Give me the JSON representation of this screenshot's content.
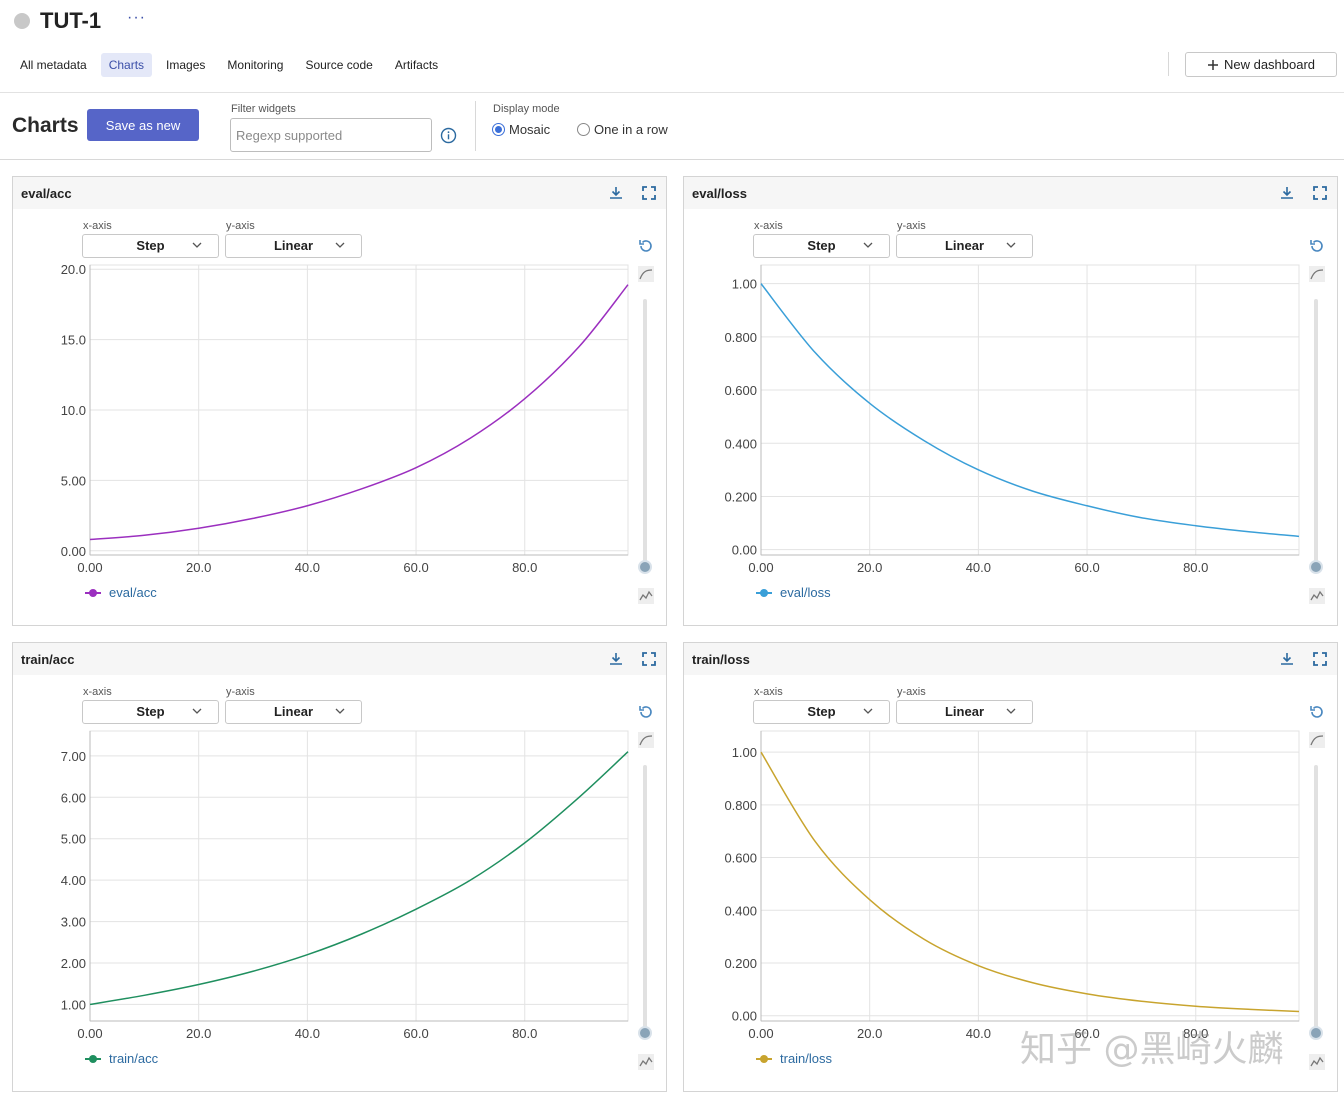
{
  "header": {
    "title": "TUT-1",
    "more_label": "···"
  },
  "tabs": [
    {
      "label": "All metadata",
      "active": false
    },
    {
      "label": "Charts",
      "active": true
    },
    {
      "label": "Images",
      "active": false
    },
    {
      "label": "Monitoring",
      "active": false
    },
    {
      "label": "Source code",
      "active": false
    },
    {
      "label": "Artifacts",
      "active": false
    }
  ],
  "new_dashboard_label": "New dashboard",
  "toolbar": {
    "title": "Charts",
    "save_label": "Save as new",
    "filter_label": "Filter widgets",
    "filter_placeholder": "Regexp supported",
    "display_mode_label": "Display mode",
    "mode_mosaic": "Mosaic",
    "mode_row": "One in a row",
    "selected_mode": "Mosaic"
  },
  "accent": "#5665c8",
  "watermark": "知乎 @黑崎火麟",
  "panels": [
    {
      "title": "eval/acc",
      "xaxis_label": "x-axis",
      "yaxis_label": "y-axis",
      "xaxis_value": "Step",
      "yaxis_value": "Linear",
      "legend": "eval/acc",
      "color": "#9b2fbf"
    },
    {
      "title": "eval/loss",
      "xaxis_label": "x-axis",
      "yaxis_label": "y-axis",
      "xaxis_value": "Step",
      "yaxis_value": "Linear",
      "legend": "eval/loss",
      "color": "#3a9fd8"
    },
    {
      "title": "train/acc",
      "xaxis_label": "x-axis",
      "yaxis_label": "y-axis",
      "xaxis_value": "Step",
      "yaxis_value": "Linear",
      "legend": "train/acc",
      "color": "#1f8f5f"
    },
    {
      "title": "train/loss",
      "xaxis_label": "x-axis",
      "yaxis_label": "y-axis",
      "xaxis_value": "Step",
      "yaxis_value": "Linear",
      "legend": "train/loss",
      "color": "#c8a42e"
    }
  ],
  "chart_data": [
    {
      "type": "line",
      "title": "eval/acc",
      "x": [
        0,
        10,
        20,
        30,
        40,
        50,
        60,
        70,
        80,
        90,
        99
      ],
      "series": [
        {
          "name": "eval/acc",
          "values": [
            0.8,
            1.1,
            1.6,
            2.3,
            3.2,
            4.4,
            5.9,
            8.0,
            10.8,
            14.5,
            18.9
          ]
        }
      ],
      "xlim": [
        0,
        99
      ],
      "ylim": [
        -0.3,
        20.3
      ],
      "x_ticks": [
        "0.00",
        "20.0",
        "40.0",
        "60.0",
        "80.0"
      ],
      "x_tick_values": [
        0,
        20,
        40,
        60,
        80
      ],
      "y_ticks": [
        "0.00",
        "5.00",
        "10.0",
        "15.0",
        "20.0"
      ],
      "y_tick_values": [
        0,
        5,
        10,
        15,
        20
      ]
    },
    {
      "type": "line",
      "title": "eval/loss",
      "x": [
        0,
        10,
        20,
        30,
        40,
        50,
        60,
        70,
        80,
        90,
        99
      ],
      "series": [
        {
          "name": "eval/loss",
          "values": [
            1.0,
            0.74,
            0.55,
            0.41,
            0.3,
            0.22,
            0.165,
            0.12,
            0.09,
            0.067,
            0.05
          ]
        }
      ],
      "xlim": [
        0,
        99
      ],
      "ylim": [
        -0.02,
        1.07
      ],
      "x_ticks": [
        "0.00",
        "20.0",
        "40.0",
        "60.0",
        "80.0"
      ],
      "x_tick_values": [
        0,
        20,
        40,
        60,
        80
      ],
      "y_ticks": [
        "0.00",
        "0.200",
        "0.400",
        "0.600",
        "0.800",
        "1.00"
      ],
      "y_tick_values": [
        0,
        0.2,
        0.4,
        0.6,
        0.8,
        1.0
      ]
    },
    {
      "type": "line",
      "title": "train/acc",
      "x": [
        0,
        10,
        20,
        30,
        40,
        50,
        60,
        70,
        80,
        90,
        99
      ],
      "series": [
        {
          "name": "train/acc",
          "values": [
            1.0,
            1.22,
            1.48,
            1.8,
            2.2,
            2.7,
            3.3,
            4.0,
            4.9,
            6.0,
            7.1
          ]
        }
      ],
      "xlim": [
        0,
        99
      ],
      "ylim": [
        0.6,
        7.6
      ],
      "x_ticks": [
        "0.00",
        "20.0",
        "40.0",
        "60.0",
        "80.0"
      ],
      "x_tick_values": [
        0,
        20,
        40,
        60,
        80
      ],
      "y_ticks": [
        "1.00",
        "2.00",
        "3.00",
        "4.00",
        "5.00",
        "6.00",
        "7.00"
      ],
      "y_tick_values": [
        1,
        2,
        3,
        4,
        5,
        6,
        7
      ]
    },
    {
      "type": "line",
      "title": "train/loss",
      "x": [
        0,
        10,
        20,
        30,
        40,
        50,
        60,
        70,
        80,
        90,
        99
      ],
      "series": [
        {
          "name": "train/loss",
          "values": [
            1.0,
            0.66,
            0.44,
            0.29,
            0.19,
            0.125,
            0.083,
            0.055,
            0.036,
            0.024,
            0.016
          ]
        }
      ],
      "xlim": [
        0,
        99
      ],
      "ylim": [
        -0.02,
        1.08
      ],
      "x_ticks": [
        "0.00",
        "20.0",
        "40.0",
        "60.0",
        "80.0"
      ],
      "x_tick_values": [
        0,
        20,
        40,
        60,
        80
      ],
      "y_ticks": [
        "0.00",
        "0.200",
        "0.400",
        "0.600",
        "0.800",
        "1.00"
      ],
      "y_tick_values": [
        0,
        0.2,
        0.4,
        0.6,
        0.8,
        1.0
      ]
    }
  ]
}
